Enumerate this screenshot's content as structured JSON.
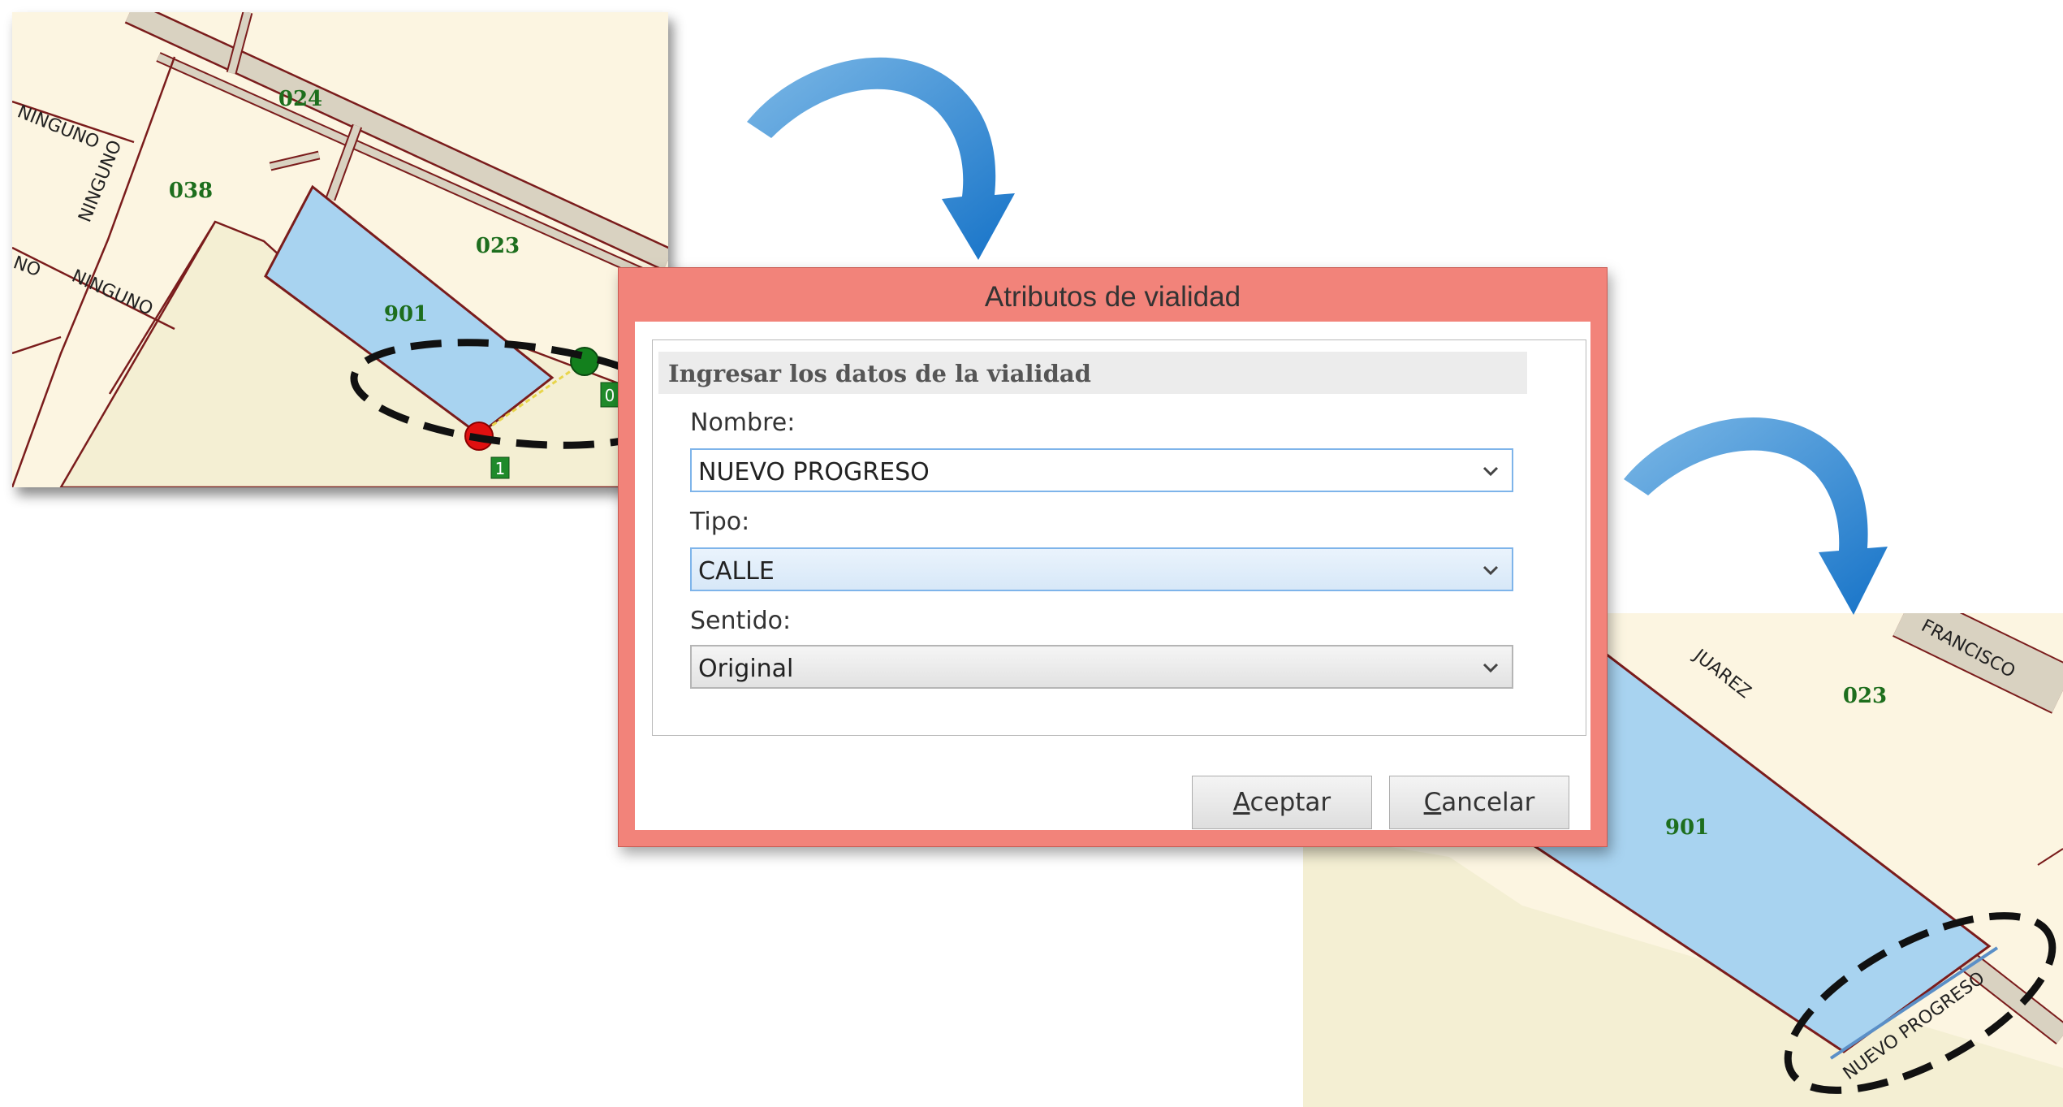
{
  "dialog": {
    "title": "Atributos de vialidad",
    "group_title": "Ingresar los datos de la vialidad",
    "fields": [
      {
        "label": "Nombre:",
        "value": "NUEVO PROGRESO"
      },
      {
        "label": "Tipo:",
        "value": "CALLE"
      },
      {
        "label": "Sentido:",
        "value": "Original"
      }
    ],
    "buttons": {
      "accept": {
        "mnemonic": "A",
        "rest": "ceptar"
      },
      "cancel": {
        "mnemonic": "C",
        "rest": "ancelar"
      }
    }
  },
  "map_before": {
    "lots": [
      "024",
      "038",
      "023",
      "901"
    ],
    "streets": [
      "NINGUNO",
      "NINGUNO",
      "NINGUNO",
      "NO"
    ],
    "node_labels": [
      "1",
      "0"
    ]
  },
  "map_after": {
    "lots": [
      "023",
      "901"
    ],
    "streets": [
      "JUAREZ",
      "FRANCISCO",
      "NUEVO PROGRESO"
    ]
  },
  "colors": {
    "dialog_frame": "#f2837a",
    "map_background": "#fcf5e1",
    "lot_fill": "#a8d3f0",
    "street_fill": "#d9d2c1",
    "lot_label": "#1d6e1d",
    "start_node": "#e01010",
    "end_node": "#13801d",
    "arrow": "#1f86d6"
  }
}
